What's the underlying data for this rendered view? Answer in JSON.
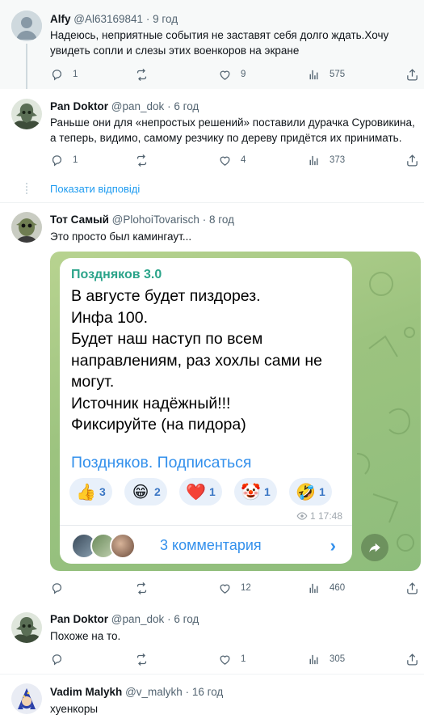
{
  "tweets": [
    {
      "name": "Alfy",
      "handle": "@Al63169841",
      "dot": "·",
      "time": "9 год",
      "text": "Надеюсь, неприятные события не заставят себя долго ждать.Хочу увидеть сопли и слезы этих военкоров на экране",
      "replies": "1",
      "retweets": "",
      "likes": "9",
      "views": "575"
    },
    {
      "name": "Pan Doktor",
      "handle": "@pan_dok",
      "dot": "·",
      "time": "6 год",
      "text": "Раньше они для «непростых решений» поставили дурачка Суровикина, а теперь, видимо, самому резчику по дереву придётся их принимать.",
      "replies": "1",
      "retweets": "",
      "likes": "4",
      "views": "373"
    },
    {
      "name": "Тот Самый",
      "handle": "@PlohoiTovarisch",
      "dot": "·",
      "time": "8 год",
      "text": "Это просто был камингаут...",
      "replies": "",
      "retweets": "",
      "likes": "12",
      "views": "460"
    },
    {
      "name": "Pan Doktor",
      "handle": "@pan_dok",
      "dot": "·",
      "time": "6 год",
      "text": "Похоже на то.",
      "replies": "",
      "retweets": "",
      "likes": "1",
      "views": "305"
    },
    {
      "name": "Vadim Malykh",
      "handle": "@v_malykh",
      "dot": "·",
      "time": "16 год",
      "text": "хуенкоры"
    }
  ],
  "show_replies": "Показати відповіді",
  "embed": {
    "channel": "Поздняков 3.0",
    "lines": [
      "В августе будет пиздорез.",
      "Инфа 100.",
      "Будет наш наступ по всем",
      "направлениям, раз хохлы сами не",
      "могут.",
      "Источник надёжный!!!",
      "Фиксируйте (на пидора)"
    ],
    "subscribe": "Поздняков. Подписаться",
    "reactions": [
      {
        "emoji": "👍",
        "count": "3"
      },
      {
        "emoji": "😁",
        "count": "2"
      },
      {
        "emoji": "❤️",
        "count": "1"
      },
      {
        "emoji": "🤡",
        "count": "1"
      },
      {
        "emoji": "🤣",
        "count": "1"
      }
    ],
    "views": "1",
    "time": "17:48",
    "comments": "3 комментария",
    "chevron": "›"
  },
  "colors": {
    "accent": "#1d9bf0",
    "telegram_link": "#3390ec",
    "channel_name": "#2ba48a"
  },
  "icons": [
    "reply-icon",
    "retweet-icon",
    "like-icon",
    "views-icon",
    "share-icon",
    "eye-icon",
    "forward-icon"
  ]
}
